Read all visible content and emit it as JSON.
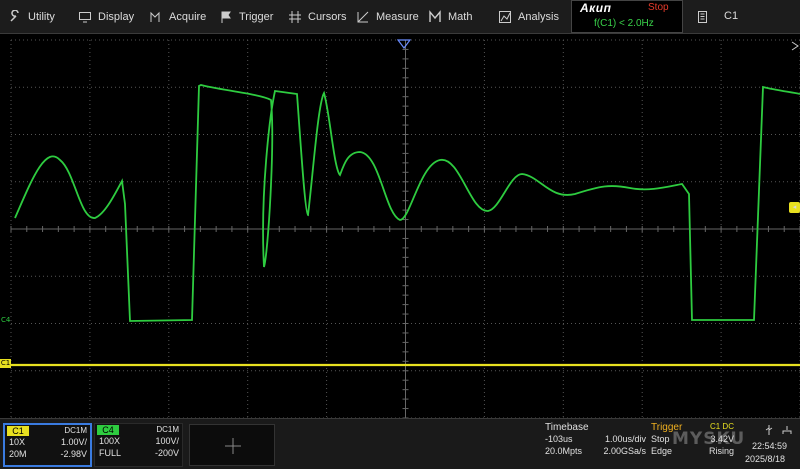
{
  "menu": {
    "utility": "Utility",
    "display": "Display",
    "acquire": "Acquire",
    "trigger": "Trigger",
    "cursors": "Cursors",
    "measure": "Measure",
    "math": "Math",
    "analysis": "Analysis"
  },
  "brand": {
    "logo": "Акип",
    "status": "Stop",
    "frequency": "f(C1) < 2.0Hz"
  },
  "channel_select": "C1",
  "markers": {
    "c4": "C4",
    "c1": "C1"
  },
  "channels": [
    {
      "tag": "C1",
      "coupling": "DC1M",
      "probe": "10X",
      "scale": "1.00V/",
      "bandwidth": "20M",
      "offset": "-2.98V",
      "color": "#e8e020"
    },
    {
      "tag": "C4",
      "coupling": "DC1M",
      "probe": "100X",
      "scale": "100V/",
      "bandwidth": "FULL",
      "offset": "-200V",
      "color": "#2ecc40"
    }
  ],
  "timebase": {
    "title": "Timebase",
    "delay": "-103us",
    "scale": "1.00us/div",
    "points": "20.0Mpts",
    "rate": "2.00GSa/s"
  },
  "trigger": {
    "title": "Trigger",
    "source": "C1 DC",
    "mode": "Stop",
    "level": "3.42V",
    "type": "Edge",
    "slope": "Rising"
  },
  "clock": "22:54:59",
  "date": "2025/8/18",
  "watermark": "MYSKU",
  "colors": {
    "ch1": "#e8e020",
    "ch4": "#2ecc40",
    "stop": "#e63a2a",
    "trigger_accent": "#f0b020"
  }
}
